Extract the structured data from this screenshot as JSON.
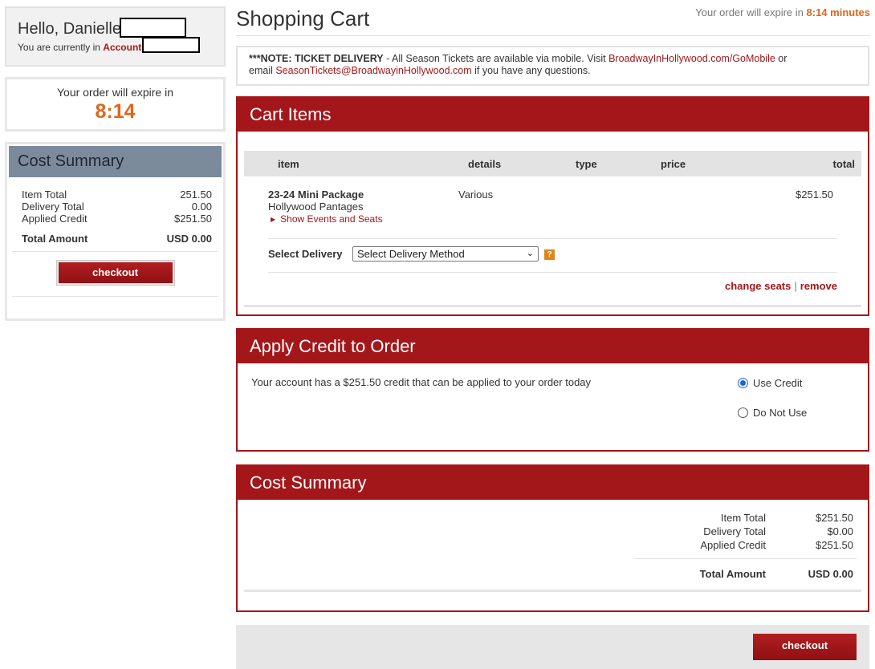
{
  "greeting": {
    "title": "Hello, Danielle",
    "sub_prefix": "You are currently in",
    "account_label": "Account"
  },
  "sidebar_timer": {
    "label": "Your order will expire in",
    "time": "8:14"
  },
  "sidebar_summary": {
    "title": "Cost Summary",
    "rows": [
      {
        "label": "Item Total",
        "value": "251.50"
      },
      {
        "label": "Delivery Total",
        "value": "0.00"
      },
      {
        "label": "Applied Credit",
        "value": "$251.50"
      }
    ],
    "total_label": "Total Amount",
    "total_value": "USD 0.00",
    "checkout_label": "checkout"
  },
  "header": {
    "title": "Shopping Cart",
    "expire_prefix": "Your order will expire in",
    "expire_value": "8:14 minutes"
  },
  "note": {
    "lead": "***NOTE: TICKET DELIVERY",
    "text1": " - All Season Tickets are available via mobile.  Visit ",
    "link1": "BroadwayInHollywood.com/GoMobile",
    "text2": " or",
    "text3": "email ",
    "link2": "SeasonTickets@BroadwayinHollywood.com",
    "text4": " if you have any questions."
  },
  "cart": {
    "title": "Cart Items",
    "columns": {
      "item": "item",
      "details": "details",
      "type": "type",
      "price": "price",
      "total": "total"
    },
    "item": {
      "name": "23-24 Mini Package",
      "venue": "Hollywood Pantages",
      "show_link": "Show Events and Seats",
      "details": "Various",
      "total": "$251.50"
    },
    "delivery_label": "Select Delivery",
    "delivery_selected": "Select Delivery Method",
    "help_icon": "?",
    "change_seats": "change seats",
    "separator": "|",
    "remove": "remove"
  },
  "credit": {
    "title": "Apply Credit to Order",
    "message": "Your account has a $251.50 credit that can be applied to your order today",
    "options": [
      {
        "label": "Use Credit",
        "selected": true
      },
      {
        "label": "Do Not Use",
        "selected": false
      }
    ]
  },
  "summary": {
    "title": "Cost Summary",
    "rows": [
      {
        "label": "Item Total",
        "value": "$251.50"
      },
      {
        "label": "Delivery Total",
        "value": "$0.00"
      },
      {
        "label": "Applied Credit",
        "value": "$251.50"
      }
    ],
    "total_label": "Total Amount",
    "total_value": "USD 0.00"
  },
  "footer": {
    "checkout_label": "checkout"
  },
  "colors": {
    "brand_red": "#a3171b",
    "timer_orange": "#e0661a",
    "summary_header": "#7b8b9c"
  }
}
